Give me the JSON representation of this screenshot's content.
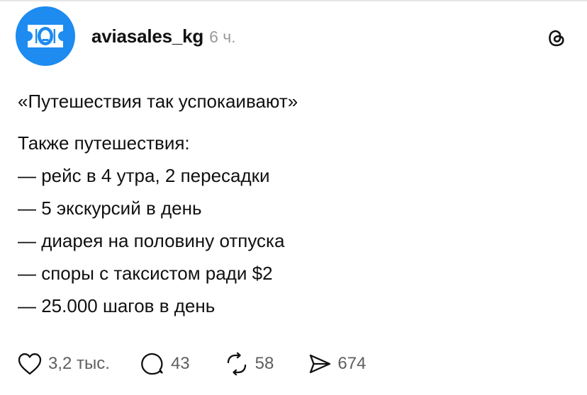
{
  "post": {
    "author": "aviasales_kg",
    "time": "6 ч.",
    "quote": "«Путешествия так успокаивают»",
    "lines": [
      "Также путешествия:",
      "— рейс в 4 утра, 2 пересадки",
      "— 5 экскурсий в день",
      "— диарея на половину отпуска",
      "— споры с таксистом ради $2",
      "— 25.000 шагов в день"
    ]
  },
  "actions": {
    "likes": "3,2 тыс.",
    "replies": "43",
    "reposts": "58",
    "shares": "674"
  },
  "icons": {
    "avatar": "aviasales-logo-icon",
    "platform": "threads-logo-icon",
    "like": "heart-icon",
    "reply": "speech-bubble-icon",
    "repost": "repost-icon",
    "share": "send-icon"
  },
  "colors": {
    "avatar_background": "#1d8bf0",
    "secondary_text": "#9a9a9a"
  }
}
